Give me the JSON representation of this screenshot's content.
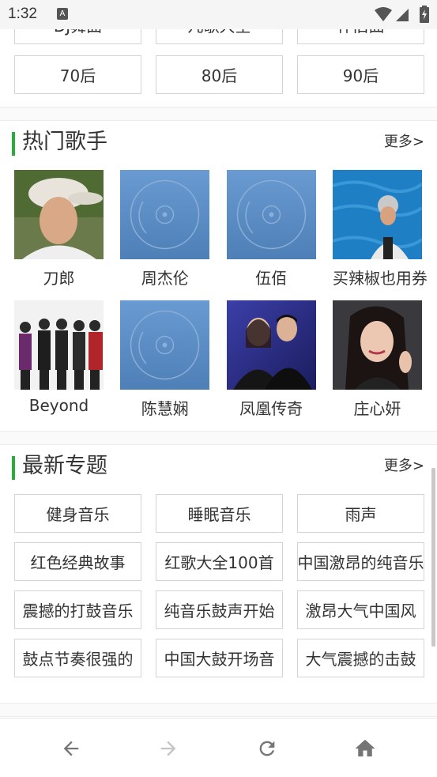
{
  "status_bar": {
    "time": "1:32",
    "notification_icon": "text-A-icon",
    "wifi_icon": "wifi-icon",
    "signal_icon": "cell-signal-icon",
    "battery_icon": "battery-icon"
  },
  "era_buttons": {
    "row_partial": [
      "DJ舞曲",
      "儿歌大全",
      "怀旧曲"
    ],
    "row_full": [
      "70后",
      "80后",
      "90后"
    ]
  },
  "hot_singers": {
    "title": "热门歌手",
    "more": "更多>",
    "items": [
      {
        "name": "刀郎",
        "image": "singer-photo-icon"
      },
      {
        "name": "周杰伦",
        "image": "vinyl-placeholder-icon"
      },
      {
        "name": "伍佰",
        "image": "vinyl-placeholder-icon"
      },
      {
        "name": "买辣椒也用券",
        "image": "singer-photo-icon"
      },
      {
        "name": "Beyond",
        "image": "band-photo-icon"
      },
      {
        "name": "陈慧娴",
        "image": "vinyl-placeholder-icon"
      },
      {
        "name": "凤凰传奇",
        "image": "duo-photo-icon"
      },
      {
        "name": "庄心妍",
        "image": "singer-photo-icon"
      }
    ]
  },
  "latest_topics": {
    "title": "最新专题",
    "more": "更多>",
    "items": [
      "健身音乐",
      "睡眠音乐",
      "雨声",
      "红色经典故事",
      "红歌大全100首",
      "中国激昂的纯音乐",
      "震撼的打鼓音乐",
      "纯音乐鼓声开始",
      "激昂大气中国风",
      "鼓点节奏很强的",
      "中国大鼓开场音",
      "大气震撼的击鼓"
    ]
  },
  "bottom_nav": {
    "back_icon": "arrow-left-icon",
    "forward_icon": "arrow-right-icon",
    "reload_icon": "reload-icon",
    "home_icon": "home-icon"
  },
  "colors": {
    "accent": "#27ae39",
    "placeholder_blue": "#5b8fc7",
    "text": "#333333",
    "nav_icon": "#757575",
    "nav_icon_disabled": "#c4c4c4"
  }
}
